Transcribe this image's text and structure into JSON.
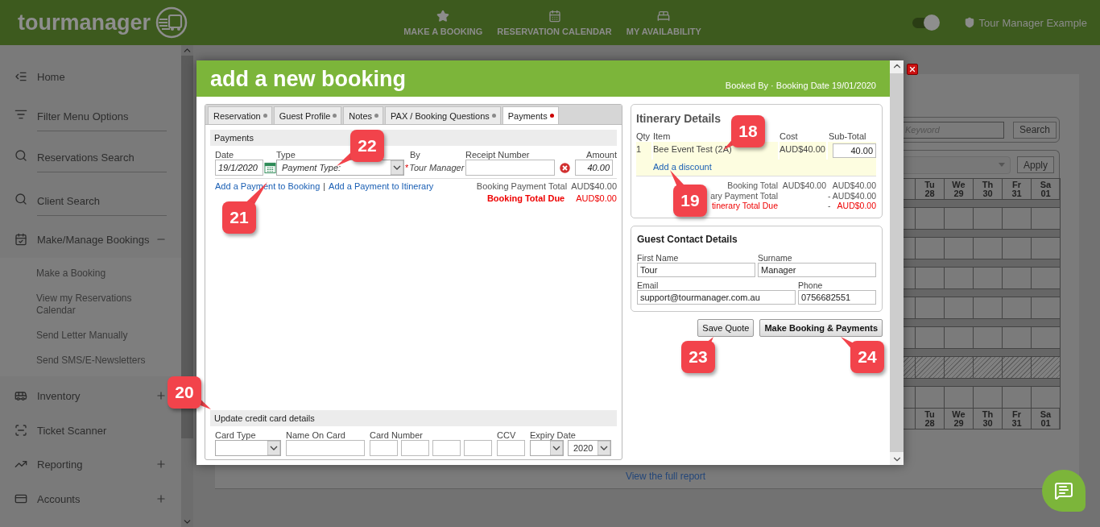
{
  "header": {
    "logo": "tourmanager",
    "nav": [
      {
        "label": "MAKE A BOOKING"
      },
      {
        "label": "RESERVATION CALENDAR"
      },
      {
        "label": "MY AVAILABILITY"
      }
    ],
    "theme_toggle": {
      "on": true
    },
    "user": "Tour Manager Example"
  },
  "sidebar": {
    "items": [
      {
        "kind": "link",
        "label": "Home"
      },
      {
        "kind": "ruled",
        "label": "Filter Menu Options"
      },
      {
        "kind": "ruled",
        "label": "Reservations Search"
      },
      {
        "kind": "ruled",
        "label": "Client Search"
      },
      {
        "kind": "group",
        "label": "Make/Manage Bookings",
        "expanded": true,
        "children": [
          {
            "label": "Make a Booking"
          },
          {
            "label": "View my Reservations Calendar"
          },
          {
            "label": "Send Letter Manually"
          },
          {
            "label": "Send SMS/E-Newsletters"
          }
        ]
      },
      {
        "kind": "group",
        "label": "Inventory",
        "expanded": false
      },
      {
        "kind": "link",
        "label": "Ticket Scanner"
      },
      {
        "kind": "group",
        "label": "Reporting",
        "expanded": false
      },
      {
        "kind": "group",
        "label": "Accounts",
        "expanded": false
      }
    ]
  },
  "background": {
    "keyword_placeholder": "Keyword",
    "search_button": "Search",
    "apply_button": "Apply",
    "calendar": {
      "days": [
        {
          "day": "Tu",
          "date": "28"
        },
        {
          "day": "We",
          "date": "29"
        },
        {
          "day": "Th",
          "date": "30"
        },
        {
          "day": "Fr",
          "date": "31"
        },
        {
          "day": "Sa",
          "date": "01"
        }
      ],
      "footer_days": [
        {
          "day": "Tu",
          "date": "28"
        },
        {
          "day": "We",
          "date": "29"
        },
        {
          "day": "Th",
          "date": "30"
        },
        {
          "day": "Fr",
          "date": "31"
        },
        {
          "day": "Sa",
          "date": "01"
        }
      ],
      "rows": [
        {
          "blocked": false
        },
        {
          "blocked": false
        },
        {
          "blocked": false
        },
        {
          "blocked": false
        },
        {
          "blocked": false
        },
        {
          "blocked": true
        },
        {
          "blocked": false
        }
      ]
    },
    "report_link": "View the full report"
  },
  "modal": {
    "title": "add a new booking",
    "booking_info": "Booked By · Booking Date 19/01/2020",
    "tabs": [
      {
        "label": "Reservation",
        "selected": false
      },
      {
        "label": "Guest Profile",
        "selected": false
      },
      {
        "label": "Notes",
        "selected": false
      },
      {
        "label": "PAX / Booking Questions",
        "selected": false
      },
      {
        "label": "Payments",
        "selected": true
      }
    ],
    "payments": {
      "heading": "Payments",
      "columns": [
        "Date",
        "Type",
        "By",
        "Receipt Number",
        "Amount"
      ],
      "row": {
        "date": "19/1/2020",
        "type_placeholder": "Payment Type:",
        "required_mark": "*",
        "by": "Tour Manager",
        "amount": "40.00"
      },
      "links": [
        "Add a Payment to Booking",
        "Add a Payment to Itinerary"
      ],
      "separator": "|",
      "payment_total": {
        "label": "Booking Payment Total",
        "value": "AUD$40.00"
      },
      "total_due": {
        "label": "Booking Total Due",
        "value": "AUD$0.00"
      }
    },
    "credit_card": {
      "heading": "Update credit card details",
      "labels": [
        "Card Type",
        "Name On Card",
        "Card Number",
        "CCV",
        "Expiry Date"
      ],
      "expiry_year": "2020"
    },
    "itinerary": {
      "heading": "Itinerary Details",
      "columns": [
        "Qty",
        "Item",
        "Cost",
        "Sub-Total"
      ],
      "items": [
        {
          "qty": "1",
          "item": "Bee Event Test (2A)",
          "cost": "AUD$40.00",
          "subtotal": "40.00"
        }
      ],
      "discount_link": "Add a discount",
      "totals": [
        {
          "kind": "normal",
          "label": "Booking Total",
          "cost": "AUD$40.00",
          "subtotal": "AUD$40.00"
        },
        {
          "kind": "normal",
          "label": "ary Payment Total",
          "subtotal": "- AUD$40.00"
        },
        {
          "kind": "due",
          "label": "tinerary Total Due",
          "sign": "-",
          "subtotal": "AUD$0.00"
        }
      ]
    },
    "guest": {
      "heading": "Guest Contact Details",
      "fields": [
        {
          "label": "First Name",
          "value": "Tour"
        },
        {
          "label": "Surname",
          "value": "Manager"
        },
        {
          "label": "Email",
          "value": "support@tourmanager.com.au"
        },
        {
          "label": "Phone",
          "value": "0756682551"
        }
      ]
    },
    "buttons": [
      {
        "kind": "secondary",
        "label": "Save Quote"
      },
      {
        "kind": "primary",
        "label": "Make Booking & Payments"
      }
    ]
  },
  "callouts": [
    {
      "label": "18"
    },
    {
      "label": "19"
    },
    {
      "label": "20"
    },
    {
      "label": "21"
    },
    {
      "label": "22"
    },
    {
      "label": "23"
    },
    {
      "label": "24"
    }
  ]
}
